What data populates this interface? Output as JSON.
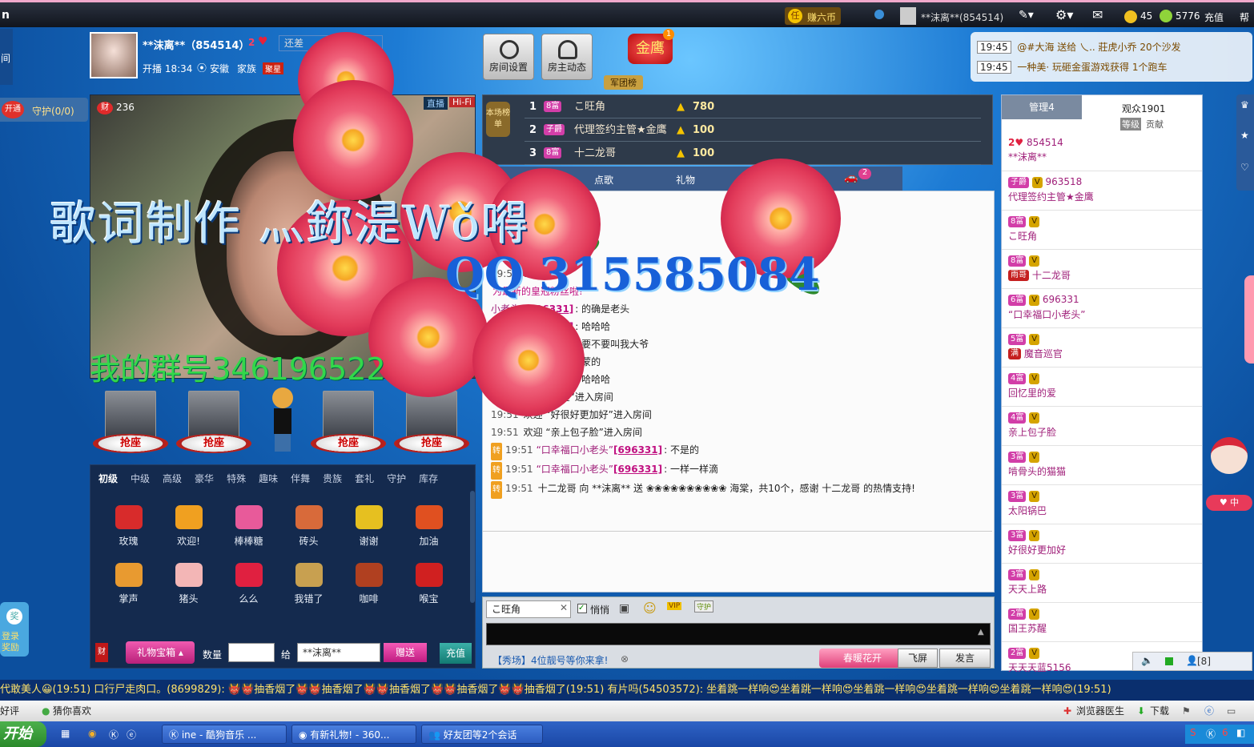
{
  "topbar": {
    "game_badge": "任",
    "game_label": "赚六币",
    "user_label": "**沫离**(854514)",
    "coins": "45",
    "beans": "5776",
    "recharge": "充值",
    "help": "帮"
  },
  "left_strip": {
    "label": "间",
    "open_badge": "开通",
    "guard": "守护(0/0)",
    "login_reward": "登录奖励"
  },
  "host": {
    "name": "**沫离**（854514）",
    "level": "2",
    "still_short": "还差",
    "start_time": "开播 18:34",
    "location": "安徽",
    "family_label": "家族",
    "family_tag": "聚星"
  },
  "room_buttons": {
    "settings": "房间设置",
    "host_news": "房主动态",
    "army": "军团榜",
    "golden_eagle": "金鹰",
    "eagle_count": "1"
  },
  "live_notices": [
    {
      "time": "19:45",
      "text": "@#大海 送给 乀.. 莊虎小乔 20个沙发"
    },
    {
      "time": "19:45",
      "text": "一种美· 玩砸金蛋游戏获得 1个跑车"
    }
  ],
  "video": {
    "wealth_badge": "财",
    "wealth_value": "236",
    "stream_tag": "直播",
    "hifi_tag": "Hi-Fi"
  },
  "watermarks": {
    "line1": "歌词制作 灬鉨湜Wǒ嘚",
    "line2": "QQ 315585084",
    "line3": "我的群号346196522"
  },
  "seats": [
    {
      "label": "抢座"
    },
    {
      "label": "抢座"
    },
    {
      "label": "抢座"
    },
    {
      "label": "抢座"
    }
  ],
  "gift_tabs": [
    "初级",
    "中级",
    "高级",
    "豪华",
    "特殊",
    "趣味",
    "伴舞",
    "贵族",
    "套礼",
    "守护",
    "库存"
  ],
  "gifts": [
    {
      "name": "玫瑰",
      "color": "#d82b2b"
    },
    {
      "name": "欢迎!",
      "color": "#f0a020"
    },
    {
      "name": "棒棒糖",
      "color": "#e85a9a"
    },
    {
      "name": "砖头",
      "color": "#d86a3a"
    },
    {
      "name": "谢谢",
      "color": "#e6c020"
    },
    {
      "name": "加油",
      "color": "#e05020"
    },
    {
      "name": "掌声",
      "color": "#e89a30"
    },
    {
      "name": "猪头",
      "color": "#f3b6b6"
    },
    {
      "name": "么么",
      "color": "#e02040"
    },
    {
      "name": "我错了",
      "color": "#c8a050"
    },
    {
      "name": "咖啡",
      "color": "#b04020"
    },
    {
      "name": "喉宝",
      "color": "#d02020"
    }
  ],
  "gift_controls": {
    "treasure": "礼物宝箱",
    "qty_label": "数量",
    "to_label": "给",
    "target": "**沫离**",
    "send": "赠送",
    "recharge": "充值",
    "wealth": "财"
  },
  "rank": {
    "title": "本场榜单",
    "rows": [
      {
        "rank": "1",
        "badge": "8富",
        "name": "こ旺角",
        "value": "780"
      },
      {
        "rank": "2",
        "badge": "子爵",
        "name": "代理签约主管★金鹰",
        "value": "100"
      },
      {
        "rank": "3",
        "badge": "8富",
        "name": "十二龙哥",
        "value": "100"
      }
    ]
  },
  "chat_tabs": {
    "song": "点歌",
    "gift": "礼物",
    "car_count": "2"
  },
  "chat_lines": [
    {
      "time": "",
      "text": "这里公告《充值获得饶"
    },
    {
      "time": "",
      "text": "…大家都来参加哦"
    },
    {
      "time": "",
      "user": "[696331]",
      "text": ":"
    },
    {
      "time": "",
      "user": "[696331]",
      "text": ": 你好老头"
    },
    {
      "time": "19:5",
      "text": "…"
    },
    {
      "time": "",
      "text": "为最新的皇冠粉丝啦!"
    },
    {
      "time": "",
      "who": "小老头”",
      "user": "[696331]",
      "text": ": 的确是老头"
    },
    {
      "time": "",
      "who": "小老头”",
      "user": "[696331]",
      "text": ": 哈哈哈"
    },
    {
      "time": "",
      "who": "小老头”",
      "user": "[696331]",
      "text": ": 要不要叫我大爷"
    },
    {
      "time": "",
      "who": "老头”",
      "user": "[696331]",
      "text": ": 内蒙的"
    },
    {
      "time": "",
      "who": "小老头”",
      "user": "[696331]",
      "text": ": 哈哈哈"
    },
    {
      "time": "19:51",
      "text": "欢迎 “…醒”进入房间"
    },
    {
      "time": "19:51",
      "text": "欢迎 “好很好更加好”进入房间"
    },
    {
      "time": "19:51",
      "text": "欢迎 “亲上包子脸”进入房间"
    },
    {
      "time": "19:51",
      "tz": "转",
      "who": "“口幸福口小老头”",
      "user": "[696331]",
      "text": ": 不是的"
    },
    {
      "time": "19:51",
      "tz": "转",
      "who": "“口幸福口小老头”",
      "user": "[696331]",
      "text": ": 一样一样滴"
    },
    {
      "time": "19:51",
      "tz": "转",
      "text": "十二龙哥 向 **沫离** 送 ❀❀❀❀❀❀❀❀❀❀ 海棠，共10个，感谢 十二龙哥 的热情支持!"
    }
  ],
  "chat_input": {
    "target": "こ旺角",
    "whisper": "悄悄",
    "spring": "春暖花开",
    "fly": "飞屏",
    "send": "发言",
    "promo": "【秀场】4位靓号等你来拿!"
  },
  "audience_tabs": {
    "manage": "管理4",
    "audience": "观众1901",
    "level": "等级",
    "contrib": "贡献"
  },
  "audience": [
    {
      "lv": "2",
      "id": "854514",
      "name": "**沫离**"
    },
    {
      "badge": "子爵",
      "id": "963518",
      "name": "代理签约主管★金鹰"
    },
    {
      "badge": "8富",
      "id": "",
      "name": "こ旺角"
    },
    {
      "badge": "8富",
      "id": "",
      "name": "十二龙哥",
      "tag": "雨哥"
    },
    {
      "badge": "6富",
      "id": "696331",
      "name": "“口幸福口小老头”"
    },
    {
      "badge": "5富",
      "id": "",
      "name": "魔音巡官",
      "tag": "满"
    },
    {
      "badge": "4富",
      "id": "",
      "name": "回忆里的爱"
    },
    {
      "badge": "4富",
      "id": "",
      "name": "亲上包子脸"
    },
    {
      "badge": "3富",
      "id": "",
      "name": "啃骨头的猫猫"
    },
    {
      "badge": "3富",
      "id": "",
      "name": "太阳锅巴"
    },
    {
      "badge": "3富",
      "id": "",
      "name": "好很好更加好"
    },
    {
      "badge": "3富",
      "id": "",
      "name": "天天上路"
    },
    {
      "badge": "2富",
      "id": "",
      "name": "国王苏醒"
    },
    {
      "badge": "2富",
      "id": "",
      "name": "天天天蓝5156"
    }
  ],
  "audience_footer": {
    "count": "[8]"
  },
  "marquee": "代敢美人😀(19:51)    口行尸走肉口。(8699829): 👹👹抽香烟了👹👹抽香烟了👹👹抽香烟了👹👹抽香烟了👹👹抽香烟了(19:51)    有片吗(54503572): 坐着跳一样响😍坐着跳一样响😍坐着跳一样响😍坐着跳一样响😍坐着跳一样响😍(19:51)",
  "browserbar": {
    "left1": "好评",
    "left2": "猜你喜欢",
    "doctor": "浏览器医生",
    "download": "下载"
  },
  "taskbar": {
    "start": "开始",
    "task1": "ine - 酷狗音乐 ...",
    "task2": "有新礼物! - 360...",
    "task3": "好友团等2个会话"
  }
}
